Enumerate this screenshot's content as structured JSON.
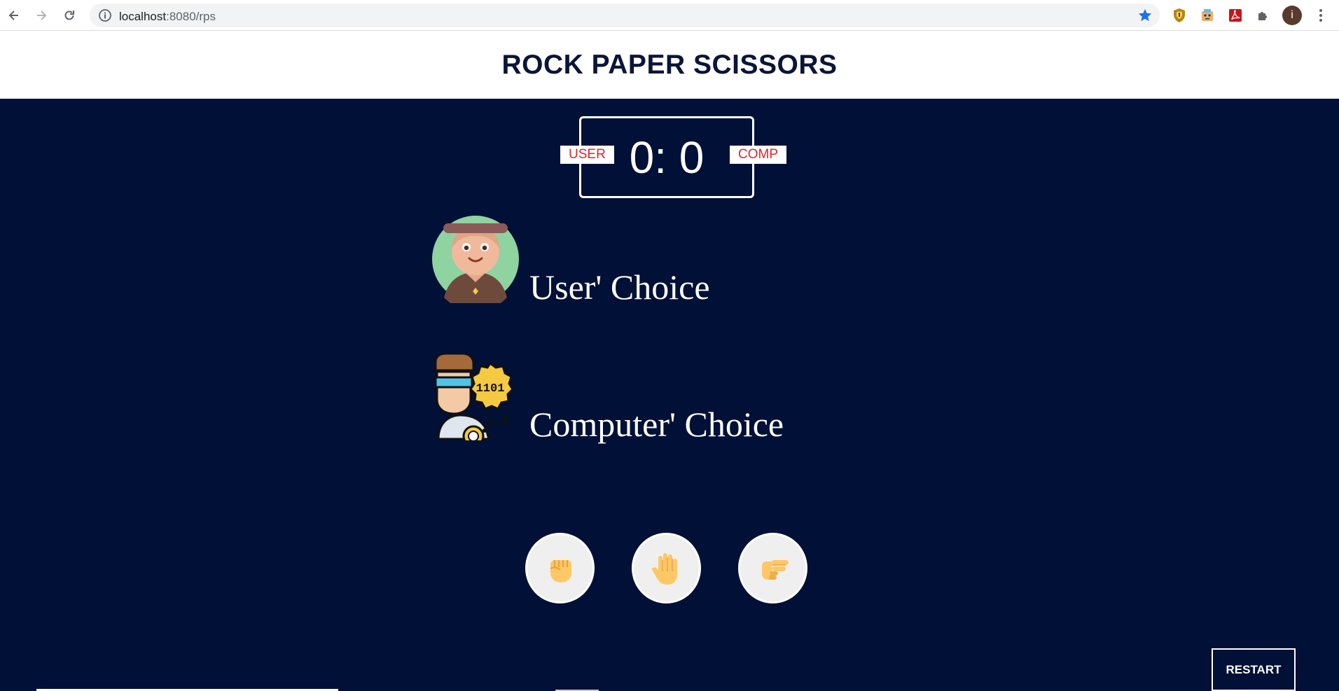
{
  "browser": {
    "url_host": "localhost",
    "url_path": ":8080/rps",
    "profile_initial": "i",
    "icons": [
      "back-arrow-icon",
      "forward-arrow-icon",
      "reload-icon",
      "info-icon",
      "bookmark-star-icon",
      "shield-extension-icon",
      "robot-extension-icon",
      "pdf-extension-icon",
      "puzzle-extensions-icon",
      "more-menu-icon"
    ]
  },
  "page": {
    "title": "ROCK PAPER SCISSORS"
  },
  "scoreboard": {
    "user_label": "USER",
    "comp_label": "COMP",
    "score": "0: 0"
  },
  "choices": {
    "user_label": "User' Choice",
    "computer_label": "Computer' Choice"
  },
  "hands": [
    {
      "name": "rock",
      "icon": "fist-icon"
    },
    {
      "name": "paper",
      "icon": "open-hand-icon"
    },
    {
      "name": "scissors",
      "icon": "peace-hand-icon"
    }
  ],
  "restart_label": "RESTART",
  "colors": {
    "background": "#011036",
    "title": "#0b1538",
    "badge_text": "#e8232c",
    "accent_star": "#1a73e8"
  }
}
